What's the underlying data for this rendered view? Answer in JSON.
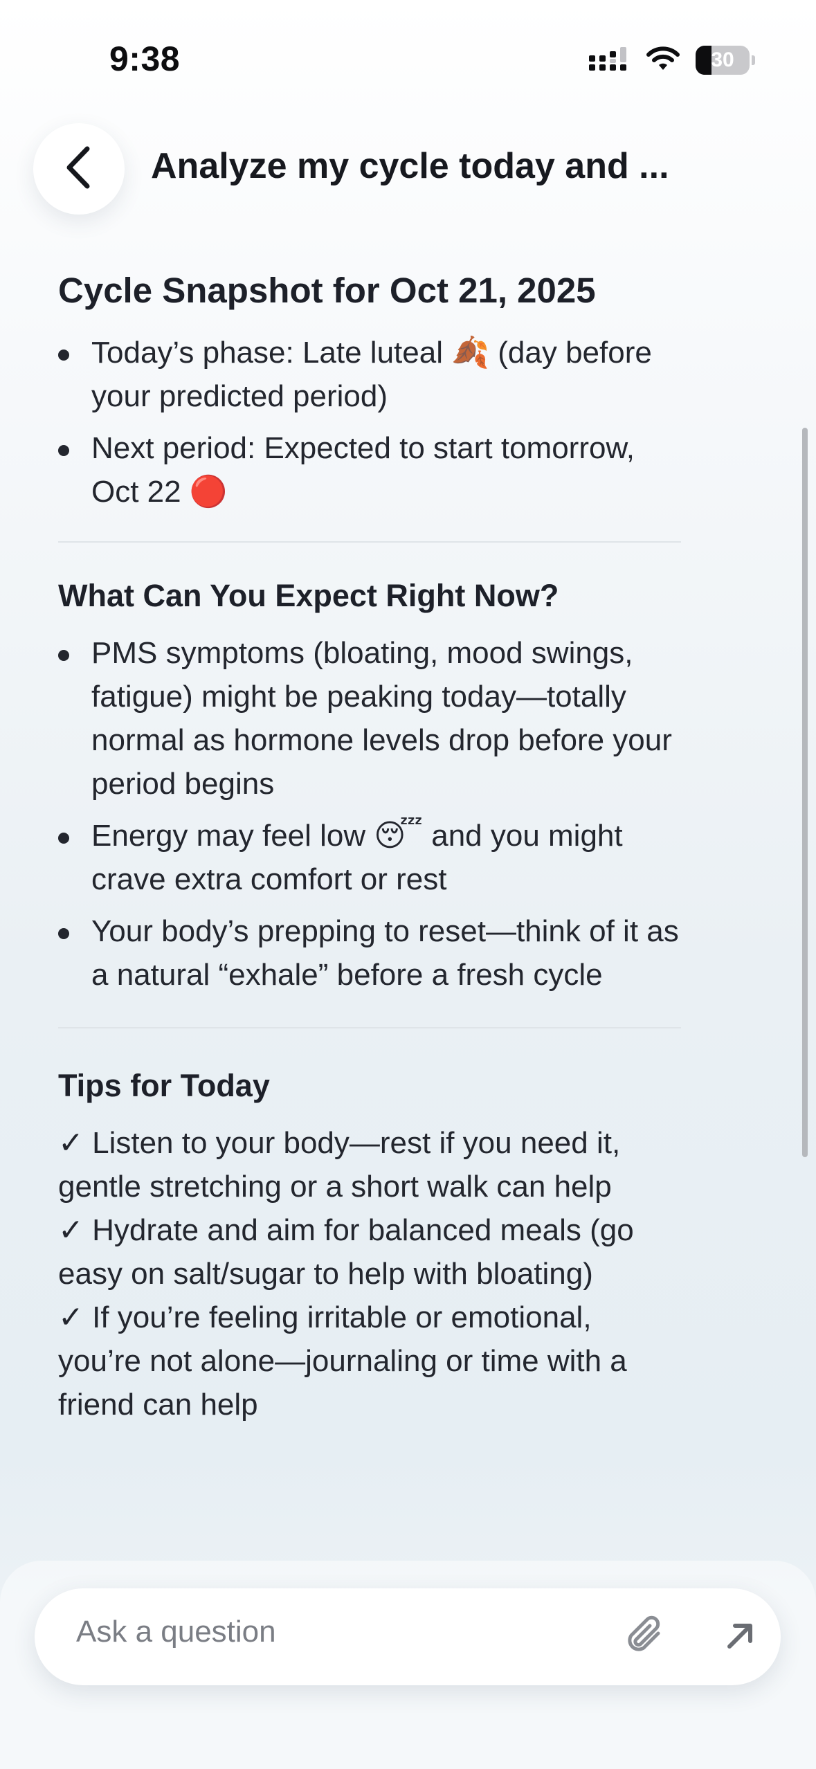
{
  "status_bar": {
    "time": "9:38",
    "battery": "30",
    "icons": [
      "signal-icon",
      "wifi-icon",
      "battery-icon"
    ]
  },
  "header": {
    "back_icon": "chevron-left-icon",
    "title": "Analyze my cycle today and ..."
  },
  "content": {
    "snapshot": {
      "heading": "Cycle Snapshot for Oct 21, 2025",
      "items": [
        {
          "text": "Today’s phase: Late luteal",
          "emoji": "🍂",
          "text_after": "(day before your predicted period)"
        },
        {
          "text": "Next period: Expected to start tomorrow, Oct 22",
          "emoji": "🔴",
          "text_after": ""
        }
      ]
    },
    "expect": {
      "heading": "What Can You Expect Right Now?",
      "items": [
        {
          "text": "PMS symptoms (bloating, mood swings, fatigue) might be peaking today—totally normal as hormone levels drop before your period begins",
          "emoji": "",
          "text_after": ""
        },
        {
          "text": "Energy may feel low",
          "emoji": "😴",
          "text_after": "and you might crave extra comfort or rest"
        },
        {
          "text": "Your body’s prepping to reset—think of it as a natural “exhale” before a fresh cycle",
          "emoji": "",
          "text_after": ""
        }
      ]
    },
    "tips": {
      "heading": "Tips for Today",
      "items": [
        "✓ Listen to your body—rest if you need it, gentle stretching or a short walk can help",
        "✓ Hydrate and aim for balanced meals (go easy on salt/sugar to help with bloating)",
        "✓ If you’re feeling irritable or emotional, you’re not alone—journaling or time with a friend can help"
      ]
    }
  },
  "input": {
    "placeholder": "Ask a question",
    "attach_icon": "paperclip-icon",
    "send_icon": "arrow-up-right-icon"
  }
}
